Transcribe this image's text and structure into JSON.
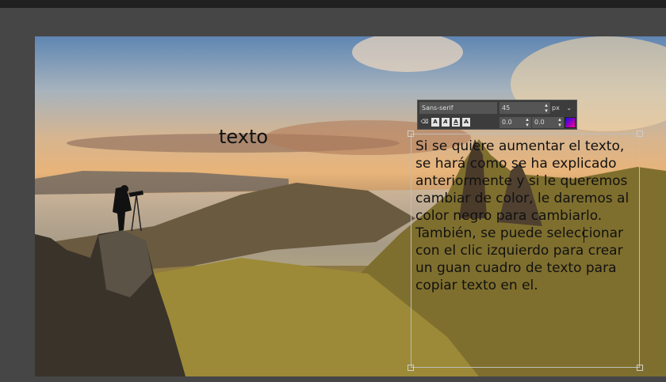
{
  "canvas": {
    "floating_text": "texto",
    "text_box_content": "Si se quiere aumentar el texto, se hará como se ha explicado anteriormente y si le queremos cambiar de color, le daremos al color negro para cambiarlo. También, se puede seleccionar con el clic izquierdo para crear un guan cuadro de texto para copiar texto en el."
  },
  "text_toolbar": {
    "font": "Sans-serif",
    "size": "45",
    "unit": "px",
    "offset_x": "0.0",
    "offset_y": "0.0",
    "format_buttons": [
      "A",
      "A",
      "A",
      "A"
    ],
    "color": "#4b10d0"
  }
}
